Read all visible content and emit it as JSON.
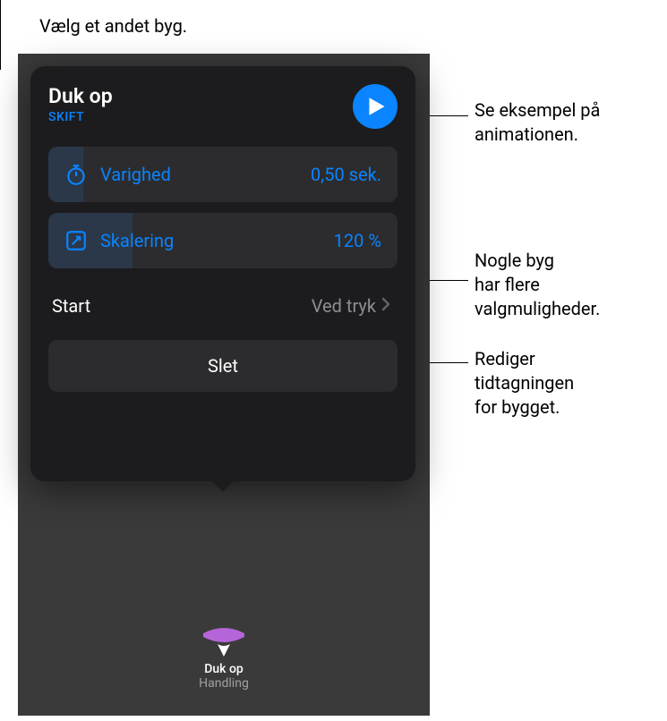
{
  "callouts": {
    "choose_other": "Vælg et andet byg.",
    "preview_line1": "Se eksempel på",
    "preview_line2": "animationen.",
    "more_options_line1": "Nogle byg",
    "more_options_line2": "har flere",
    "more_options_line3": "valgmuligheder.",
    "edit_timing_line1": "Rediger",
    "edit_timing_line2": "tidtagningen",
    "edit_timing_line3": "for bygget."
  },
  "popover": {
    "title": "Duk op",
    "change_label": "SKIFT",
    "duration": {
      "label": "Varighed",
      "value": "0,50 sek.",
      "fill_percent": 10
    },
    "scale": {
      "label": "Skalering",
      "value": "120 %",
      "fill_percent": 24
    },
    "start": {
      "label": "Start",
      "value": "Ved tryk"
    },
    "delete_label": "Slet"
  },
  "build_item": {
    "name": "Duk op",
    "type": "Handling"
  },
  "colors": {
    "accent": "#0a84ff",
    "row_bg": "#2c2c2e",
    "panel_bg": "#1c1c1e",
    "build_purple": "#b565d9"
  }
}
